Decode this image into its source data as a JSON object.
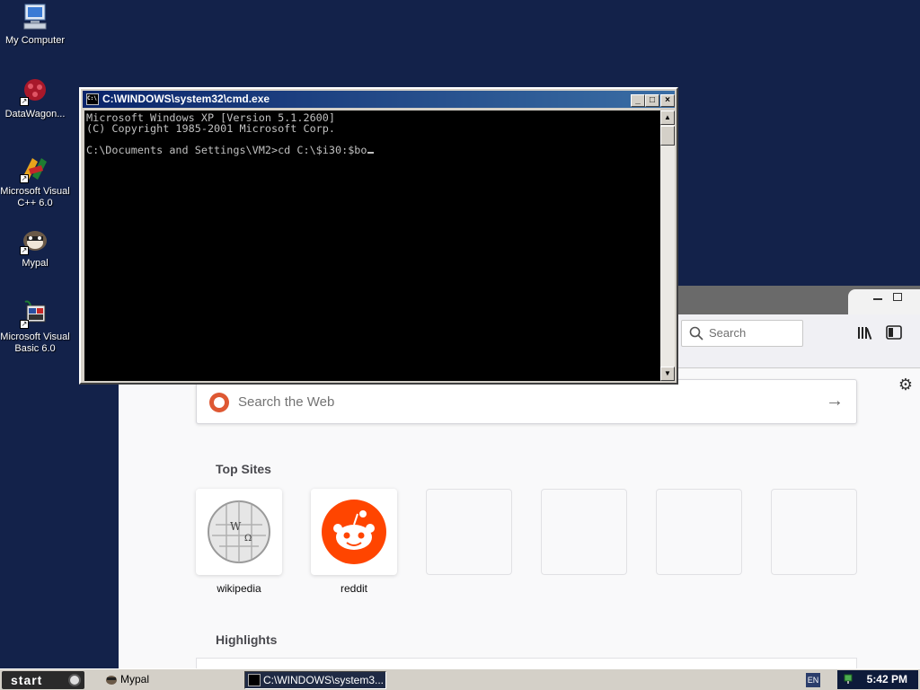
{
  "desktop": {
    "icons": [
      {
        "label": "My Computer",
        "icon": "my-computer-icon"
      },
      {
        "label": "DataWagon...",
        "icon": "datawagon-icon"
      },
      {
        "label": "Microsoft Visual C++ 6.0",
        "icon": "visual-cpp-icon"
      },
      {
        "label": "Mypal",
        "icon": "mypal-icon"
      },
      {
        "label": "Microsoft Visual Basic 6.0",
        "icon": "visual-basic-icon"
      }
    ]
  },
  "cmd": {
    "title": "C:\\WINDOWS\\system32\\cmd.exe",
    "icon_text": "C:\\",
    "lines": [
      "Microsoft Windows XP [Version 5.1.2600]",
      "(C) Copyright 1985-2001 Microsoft Corp.",
      "",
      "C:\\Documents and Settings\\VM2>cd C:\\$i30:$bo"
    ],
    "buttons": {
      "minimize": "_",
      "maximize": "□",
      "close": "×"
    }
  },
  "browser": {
    "search_placeholder": "Search",
    "web_search_placeholder": "Search the Web",
    "top_sites_title": "Top Sites",
    "highlights_title": "Highlights",
    "top_sites": [
      {
        "label": "wikipedia"
      },
      {
        "label": "reddit"
      },
      {
        "label": ""
      },
      {
        "label": ""
      },
      {
        "label": ""
      },
      {
        "label": ""
      }
    ],
    "colors": {
      "reddit": "#ff4500",
      "ddg": "#de5833"
    }
  },
  "taskbar": {
    "start_label": "start",
    "tasks": [
      {
        "label": "Mypal",
        "active": false
      },
      {
        "label": "C:\\WINDOWS\\system3...",
        "active": true
      }
    ],
    "language": "EN",
    "clock": "5:42 PM"
  }
}
